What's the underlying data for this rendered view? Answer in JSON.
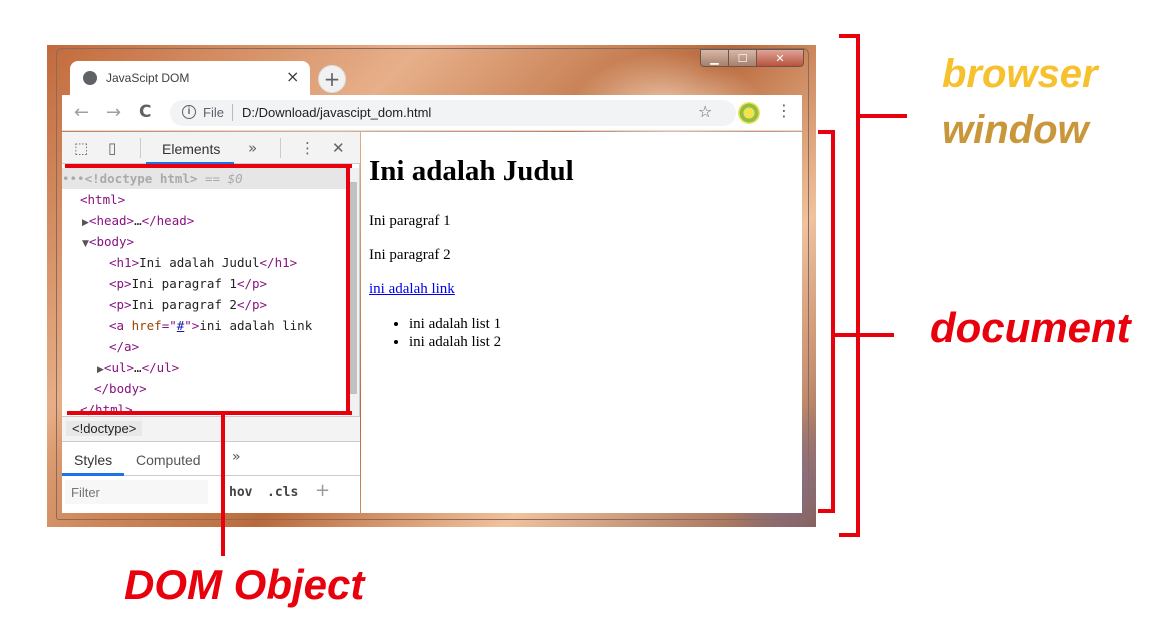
{
  "window": {
    "controls": {
      "minimize": "▁",
      "maximize": "☐",
      "close": "✕"
    }
  },
  "tab": {
    "title": "JavaScipt DOM",
    "close": "×",
    "new_tab": "+"
  },
  "toolbar": {
    "back": "←",
    "forward": "→",
    "reload": "C",
    "info": "i",
    "scheme": "File",
    "url": "D:/Download/javascipt_dom.html",
    "star": "☆",
    "menu": "⋮"
  },
  "devtools": {
    "inspect_icon": "⬚",
    "device_icon": "▯",
    "tab_elements": "Elements",
    "more_tabs": "»",
    "menu": "⋮",
    "close": "✕",
    "dom": {
      "doctype": "<!doctype html>",
      "selected_suffix": " == $0",
      "html_open": "<html>",
      "head_open": "<head>",
      "head_dots": "…",
      "head_close": "</head>",
      "body_open": "<body>",
      "h1_open": "<h1>",
      "h1_text": "Ini adalah Judul",
      "h1_close": "</h1>",
      "p_open": "<p>",
      "p1_text": "Ini paragraf 1",
      "p_close": "</p>",
      "p2_text": "Ini paragraf 2",
      "a_open_start": "<a ",
      "a_attr": "href",
      "a_eq": "=\"",
      "a_val": "#",
      "a_eq_end": "\">",
      "a_text": "ini adalah link",
      "a_close": "</a>",
      "ul_open": "<ul>",
      "ul_dots": "…",
      "ul_close": "</ul>",
      "body_close": "</body>",
      "html_close": "</html>"
    },
    "breadcrumb": "<!doctype>",
    "styles_tabs": [
      "Styles",
      "Computed",
      "»"
    ],
    "filter_placeholder": "Filter",
    "hov": "hov",
    "cls": ".cls",
    "plus": "+"
  },
  "page": {
    "heading": "Ini adalah Judul",
    "para1": "Ini paragraf 1",
    "para2": "Ini paragraf 2",
    "link": "ini adalah link",
    "list": [
      "ini adalah list 1",
      "ini adalah list 2"
    ]
  },
  "annotations": {
    "browser_window": [
      "browser",
      "window"
    ],
    "document": "document",
    "dom_object": "DOM Object",
    "colors": {
      "red": "#e8000c",
      "gold_top": "#f6c12c",
      "gold_bottom": "#c9963a"
    }
  }
}
